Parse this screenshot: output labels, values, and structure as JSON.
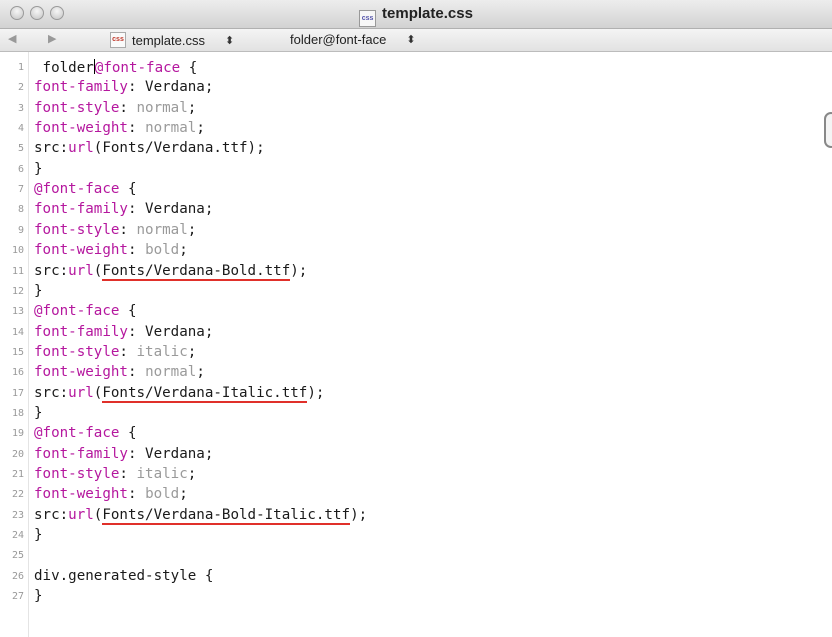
{
  "window": {
    "title": "template.css",
    "title_icon": "css-file-icon"
  },
  "navbar": {
    "file_label": "template.css",
    "symbol_label": "folder@font-face",
    "back_icon": "back-arrow-icon",
    "forward_icon": "forward-arrow-icon"
  },
  "code": {
    "lines": [
      {
        "n": "1",
        "t": " folder@font-face {"
      },
      {
        "n": "2",
        "t": "font-family: Verdana;"
      },
      {
        "n": "3",
        "t": "font-style: normal;"
      },
      {
        "n": "4",
        "t": "font-weight: normal;"
      },
      {
        "n": "5",
        "t": "src:url(Fonts/Verdana.ttf);"
      },
      {
        "n": "6",
        "t": "}"
      },
      {
        "n": "7",
        "t": "@font-face {"
      },
      {
        "n": "8",
        "t": "font-family: Verdana;"
      },
      {
        "n": "9",
        "t": "font-style: normal;"
      },
      {
        "n": "10",
        "t": "font-weight: bold;"
      },
      {
        "n": "11",
        "t": "src:url(Fonts/Verdana-Bold.ttf);"
      },
      {
        "n": "12",
        "t": "}"
      },
      {
        "n": "13",
        "t": "@font-face {"
      },
      {
        "n": "14",
        "t": "font-family: Verdana;"
      },
      {
        "n": "15",
        "t": "font-style: italic;"
      },
      {
        "n": "16",
        "t": "font-weight: normal;"
      },
      {
        "n": "17",
        "t": "src:url(Fonts/Verdana-Italic.ttf);"
      },
      {
        "n": "18",
        "t": "}"
      },
      {
        "n": "19",
        "t": "@font-face {"
      },
      {
        "n": "20",
        "t": "font-family: Verdana;"
      },
      {
        "n": "21",
        "t": "font-style: italic;"
      },
      {
        "n": "22",
        "t": "font-weight: bold;"
      },
      {
        "n": "23",
        "t": "src:url(Fonts/Verdana-Bold-Italic.ttf);"
      },
      {
        "n": "24",
        "t": "}"
      },
      {
        "n": "25",
        "t": ""
      },
      {
        "n": "26",
        "t": "div.generated-style {"
      },
      {
        "n": "27",
        "t": "}"
      }
    ]
  },
  "colors": {
    "keyword": "#b5179e",
    "value": "#9a9a9a",
    "error_underline": "#e0302a"
  }
}
